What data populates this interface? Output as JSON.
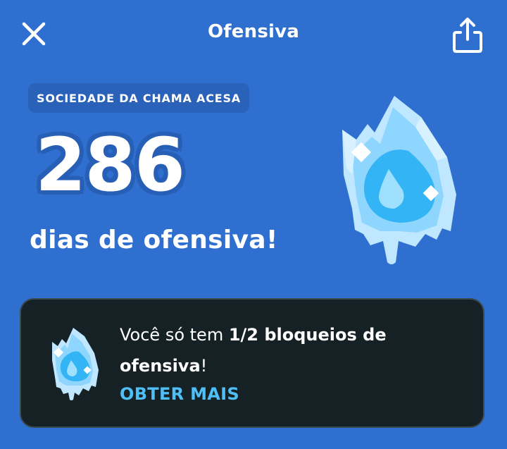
{
  "header": {
    "title": "Ofensiva"
  },
  "streak": {
    "society_label": "SOCIEDADE DA CHAMA ACESA",
    "days": "286",
    "label": "dias de ofensiva!"
  },
  "freeze_card": {
    "text_prefix": "Você só tem ",
    "text_bold": "1/2 bloqueios de ofensiva",
    "text_suffix": "!",
    "action_label": "OBTER MAIS"
  },
  "colors": {
    "background": "#2f6fcf",
    "card_background": "#162125",
    "action_link": "#4ec0f7",
    "ice_light": "#bfe7ff",
    "ice_mid": "#7fd0ff",
    "ice_drop": "#1fa7f2"
  },
  "icons": {
    "close": "close-icon",
    "share": "share-icon",
    "frozen_flame": "frozen-flame-icon"
  }
}
